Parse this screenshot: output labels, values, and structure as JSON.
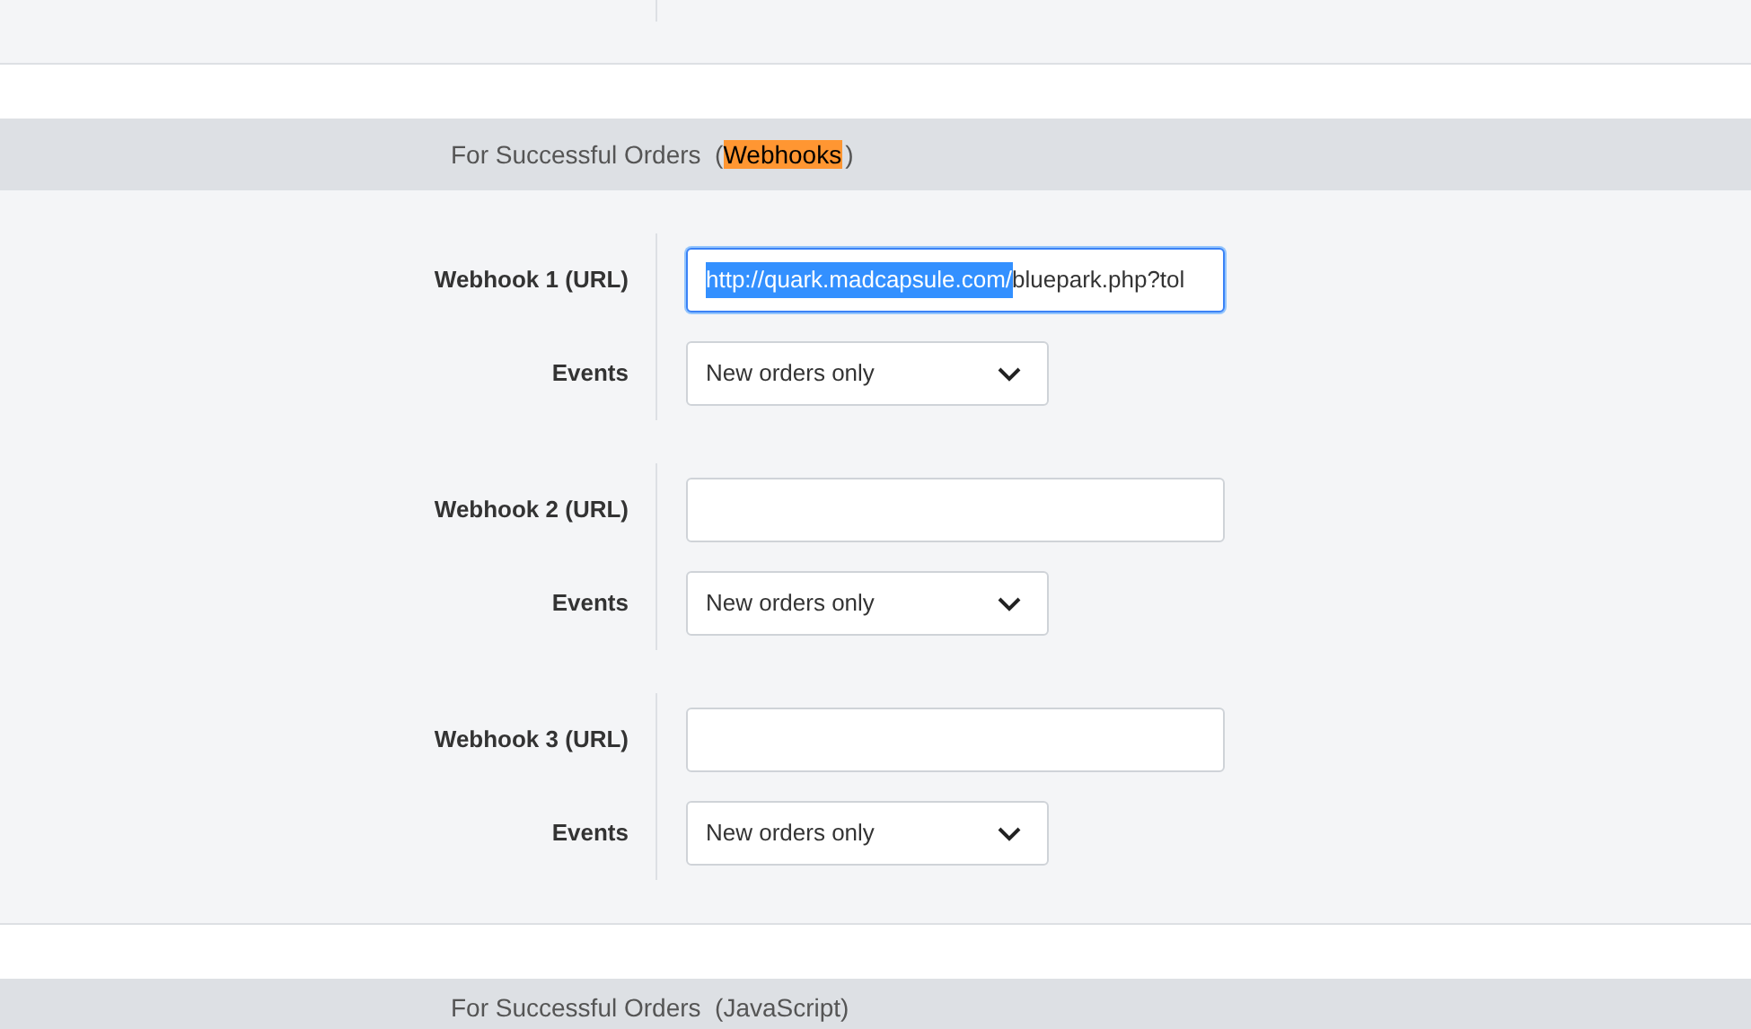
{
  "sections": [
    {
      "heading": [
        {
          "text": "For Successful Orders  (",
          "highlighted": false
        },
        {
          "text": "Webhooks",
          "highlighted": true
        },
        {
          "text": ")",
          "highlighted": false
        }
      ],
      "webhooks": [
        {
          "url_label": "Webhook 1 (URL)",
          "url_selected": "http://quark.madcapsule.com/",
          "url_rest": "bluepark.php?tol",
          "focused": true,
          "events_label": "Events",
          "events_value": "New orders only"
        },
        {
          "url_label": "Webhook 2 (URL)",
          "focused": false,
          "events_label": "Events",
          "events_value": "New orders only"
        },
        {
          "url_label": "Webhook 3 (URL)",
          "focused": false,
          "events_label": "Events",
          "events_value": "New orders only"
        }
      ]
    },
    {
      "heading": [
        {
          "text": "For Successful Orders  (JavaScript)",
          "highlighted": false
        }
      ]
    }
  ]
}
